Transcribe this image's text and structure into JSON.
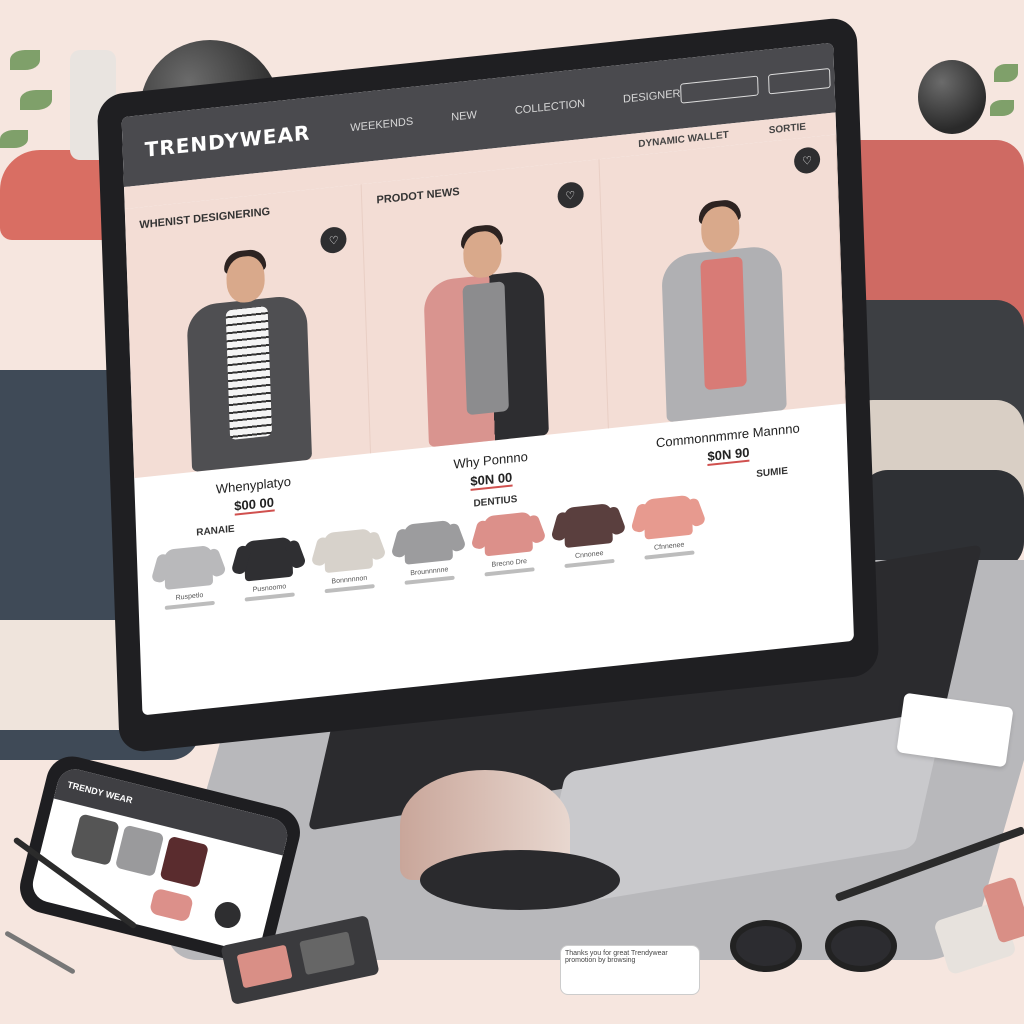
{
  "site": {
    "logo": "TRENDYWEAR",
    "nav": [
      "WEEKENDS",
      "NEW",
      "COLLECTION",
      "DESIGNER"
    ],
    "header_buttons": [
      "",
      ""
    ],
    "header_right_labels": [
      "DYNAMIC WALLET",
      "SORTIE"
    ]
  },
  "hero": {
    "cards": [
      {
        "section_label": "WHENIST DESIGNERING",
        "name": "Whenyplatyo",
        "price": "$00 00",
        "shirt_color": "#4f4f52",
        "inner_color": "#f5f5f5"
      },
      {
        "section_label": "PRODOT NEWS",
        "name": "Why Ponnno",
        "price": "$0N 00",
        "shirt_color": "#d9948f",
        "inner_color": "#8c8c8e"
      },
      {
        "section_label": "",
        "name": "Commonnmmre Mannno",
        "price": "$0N 90",
        "shirt_color": "#b0b0b3",
        "inner_color": "#d87b76"
      }
    ]
  },
  "sub_sections": [
    "RANAIE",
    "DENTIUS",
    "SUMIE"
  ],
  "thumbs": [
    {
      "label": "Ruspetlo",
      "color": "#b9b9bb"
    },
    {
      "label": "Pusnoomo",
      "color": "#2f2f32"
    },
    {
      "label": "Bonnnnnon",
      "color": "#d7d2cb"
    },
    {
      "label": "Brounnnnne",
      "color": "#9c9c9e"
    },
    {
      "label": "Brecno Dre",
      "color": "#dc908a"
    },
    {
      "label": "Cnnonee",
      "color": "#5a3f3e"
    },
    {
      "label": "Cfnnenee",
      "color": "#e79a8f"
    }
  ],
  "phone": {
    "title": "TRENDY WEAR"
  },
  "tag_text": "Thanks you for great Trendywear promotion by browsing",
  "colors": {
    "header": "#4a4a4e",
    "accent": "#d0504e",
    "hero_bg": "#f3ddd5",
    "desk": "#f6e6df"
  }
}
